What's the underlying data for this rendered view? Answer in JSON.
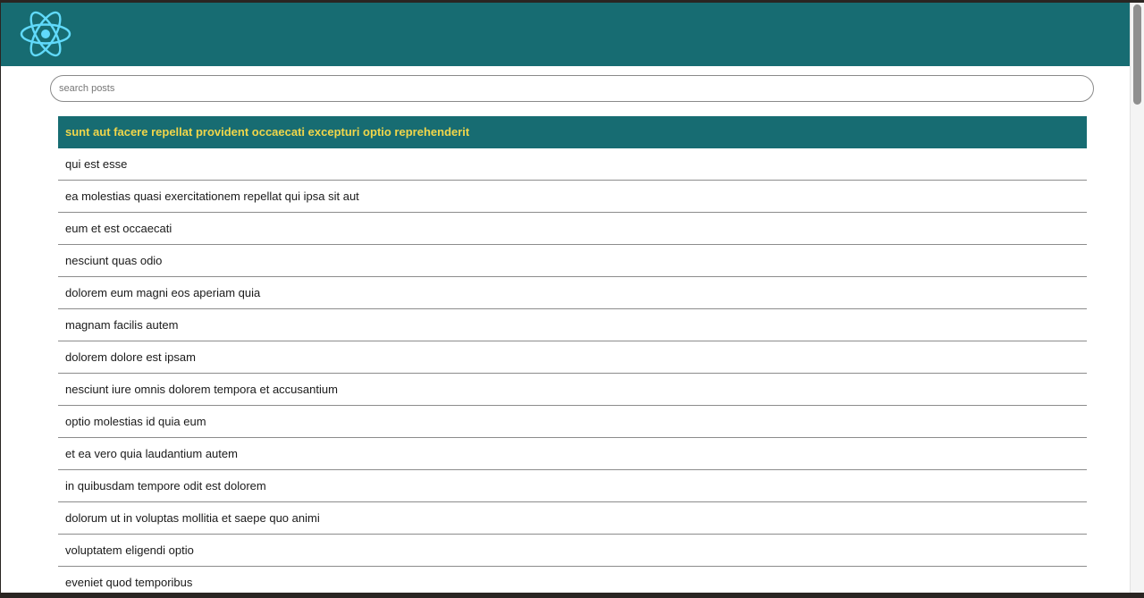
{
  "header": {
    "logo_icon": "react-atom-icon",
    "background_color": "#176c72",
    "logo_color": "#61dafb"
  },
  "search": {
    "placeholder": "search posts",
    "value": ""
  },
  "posts": [
    {
      "title": "sunt aut facere repellat provident occaecati excepturi optio reprehenderit",
      "selected": true
    },
    {
      "title": "qui est esse"
    },
    {
      "title": "ea molestias quasi exercitationem repellat qui ipsa sit aut"
    },
    {
      "title": "eum et est occaecati"
    },
    {
      "title": "nesciunt quas odio"
    },
    {
      "title": "dolorem eum magni eos aperiam quia"
    },
    {
      "title": "magnam facilis autem"
    },
    {
      "title": "dolorem dolore est ipsam"
    },
    {
      "title": "nesciunt iure omnis dolorem tempora et accusantium"
    },
    {
      "title": "optio molestias id quia eum"
    },
    {
      "title": "et ea vero quia laudantium autem"
    },
    {
      "title": "in quibusdam tempore odit est dolorem"
    },
    {
      "title": "dolorum ut in voluptas mollitia et saepe quo animi"
    },
    {
      "title": "voluptatem eligendi optio"
    },
    {
      "title": "eveniet quod temporibus"
    }
  ],
  "colors": {
    "selected_background": "#176c72",
    "selected_text": "#f0d64a"
  }
}
